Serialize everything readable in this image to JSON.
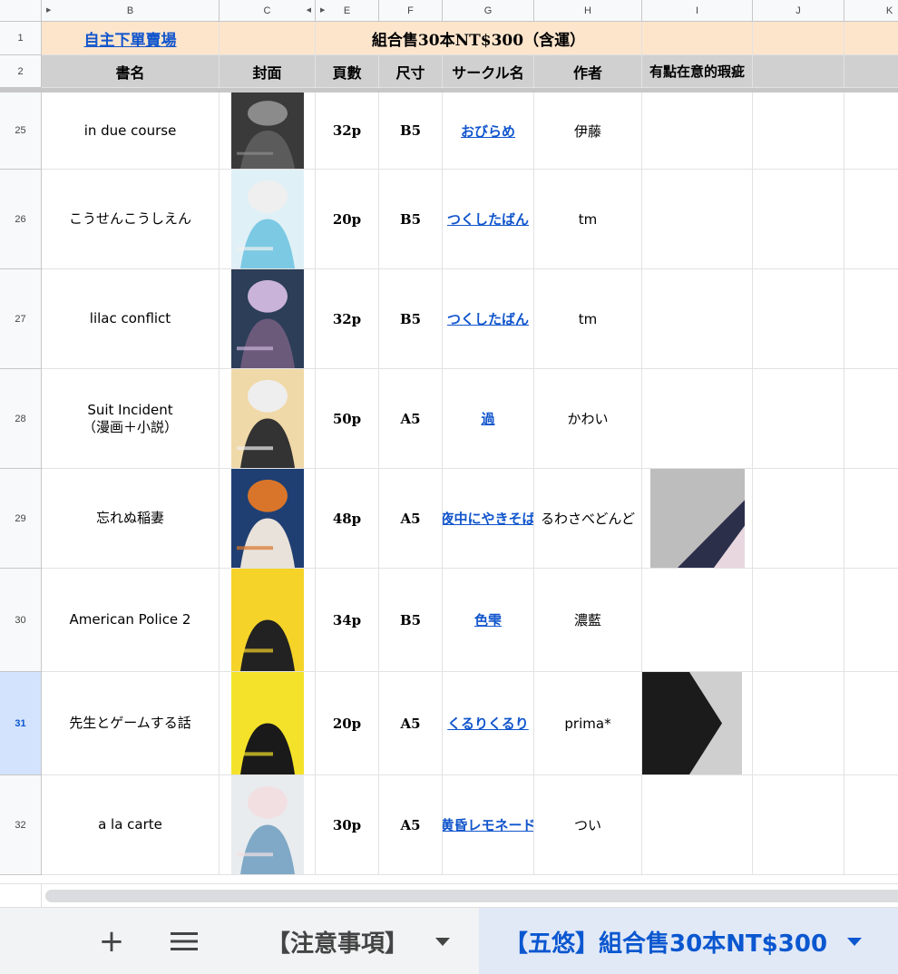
{
  "columns": [
    "B",
    "C",
    "E",
    "F",
    "G",
    "H",
    "I",
    "J",
    "K"
  ],
  "row1": {
    "b_link": "自主下單賣場",
    "merged_title": "組合售30本NT$300（含運）"
  },
  "headers": {
    "title": "書名",
    "cover": "封面",
    "pages": "頁數",
    "size": "尺寸",
    "circle": "サークル名",
    "author": "作者",
    "flaw": "有點在意的瑕疵"
  },
  "frozen_row_numbers": [
    "1",
    "2"
  ],
  "rows": [
    {
      "num": "25",
      "title": "in due course",
      "pages": "32p",
      "size": "B5",
      "circle": "おびらめ",
      "author": "伊藤",
      "flaw_photo": false
    },
    {
      "num": "26",
      "title": "こうせんこうしえん",
      "pages": "20p",
      "size": "B5",
      "circle": "つくしたばん",
      "author": "tm",
      "flaw_photo": false
    },
    {
      "num": "27",
      "title": "lilac conflict",
      "pages": "32p",
      "size": "B5",
      "circle": "つくしたばん",
      "author": "tm",
      "flaw_photo": false
    },
    {
      "num": "28",
      "title": "Suit Incident\n（漫画＋小説）",
      "pages": "50p",
      "size": "A5",
      "circle": "過",
      "author": "かわい",
      "flaw_photo": false
    },
    {
      "num": "29",
      "title": "忘れぬ稲妻",
      "pages": "48p",
      "size": "A5",
      "circle": "夜中にやきそば",
      "author": "るわさべどんど",
      "flaw_photo": true
    },
    {
      "num": "30",
      "title": "American Police 2",
      "pages": "34p",
      "size": "B5",
      "circle": "色雫",
      "author": "濃藍",
      "flaw_photo": false
    },
    {
      "num": "31",
      "title": "先生とゲームする話",
      "pages": "20p",
      "size": "A5",
      "circle": "くるりくるり",
      "author": "prima*",
      "flaw_photo": true
    },
    {
      "num": "32",
      "title": "a la carte",
      "pages": "30p",
      "size": "A5",
      "circle": "黄昏レモネード",
      "author": "つい",
      "flaw_photo": false
    }
  ],
  "selected_row": "31",
  "tabs": {
    "add": "+",
    "menu": "≡",
    "items": [
      {
        "label": "【注意事項】",
        "active": false
      },
      {
        "label": "【五悠】組合售30本NT$300",
        "active": true
      }
    ]
  }
}
